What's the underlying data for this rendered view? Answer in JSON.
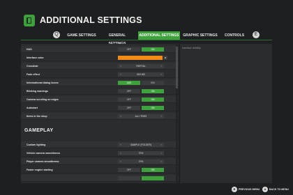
{
  "header": {
    "title": "ADDITIONAL SETTINGS",
    "logo_icon": "settings-logo-icon"
  },
  "tabs": {
    "prev_key": "Q",
    "next_key": "E",
    "items": [
      {
        "label": "GAME SETTINGS",
        "active": false
      },
      {
        "label": "GENERAL SETTINGS",
        "active": false
      },
      {
        "label": "ADDITIONAL SETTINGS",
        "active": true
      },
      {
        "label": "GRAPHIC SETTINGS",
        "active": false
      },
      {
        "label": "CONTROLS",
        "active": false
      }
    ]
  },
  "side_panel": {
    "text": "Interface visibility"
  },
  "settings": {
    "hud": {
      "label": "HUD",
      "off": "OFF",
      "on": "ON",
      "value": "ON"
    },
    "interface_color": {
      "label": "Interface color",
      "value_color": "#f28c17"
    },
    "crosshair": {
      "label": "Crosshair",
      "value": "PARTIAL"
    },
    "fade_effect": {
      "label": "Fade effect",
      "value": "500 MS"
    },
    "info_dialog": {
      "label": "Informational dialog boxes",
      "off": "AUS",
      "on": "EIN",
      "value": "AUS"
    },
    "blinking_warnings": {
      "label": "Blinking warnings",
      "off": "OFF",
      "on": "ON",
      "value": "ON"
    },
    "camera_scrolling": {
      "label": "Camera scrolling on edges",
      "off": "OFF",
      "on": "ON",
      "value": "ON"
    },
    "autostart": {
      "label": "Autostart",
      "off": "OFF",
      "on": "ON",
      "value": "ON"
    },
    "items_in_shop": {
      "label": "Items in the shop",
      "value": "ALL ITEMS"
    }
  },
  "gameplay": {
    "title": "GAMEPLAY",
    "custom_lighting": {
      "label": "Custom lighting",
      "value": "SAMPLE (FOLDER)"
    },
    "vehicle_camera": {
      "label": "Vehicle camera smoothness",
      "value": "70%"
    },
    "player_camera": {
      "label": "Player camera smoothness",
      "value": "70%"
    },
    "faster_engine": {
      "label": "Faster engine starting",
      "off": "OFF",
      "on": "ON",
      "value": "ON"
    }
  },
  "footer": {
    "previous": {
      "key": "B",
      "label": "PREVIOUS MENU"
    },
    "back": {
      "key": "A",
      "label": "BACK TO MENU"
    }
  },
  "colors": {
    "accent": "#3ea13b",
    "background": "#1d1f21",
    "panel": "#2a2c2e"
  }
}
